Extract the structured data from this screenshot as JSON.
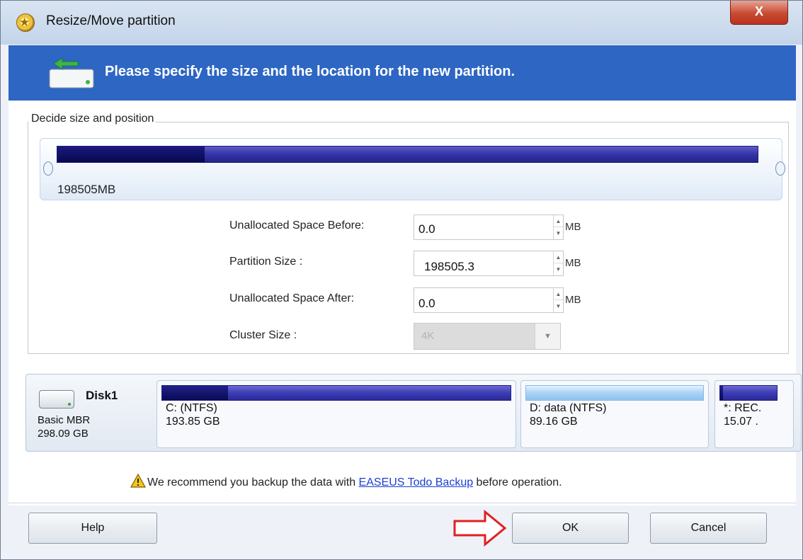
{
  "window": {
    "title": "Resize/Move partition",
    "close_label": "X"
  },
  "banner": {
    "text": "Please specify the size and the location for the new partition."
  },
  "group": {
    "label": "Decide size and position",
    "partition_size_label": "198505MB",
    "used_fraction": 0.21
  },
  "fields": {
    "before": {
      "label": "Unallocated Space Before:",
      "value": "0.0",
      "unit": "MB"
    },
    "size": {
      "label": "Partition Size :",
      "value": "198505.3",
      "unit": "MB"
    },
    "after": {
      "label": "Unallocated Space After:",
      "value": "0.0",
      "unit": "MB"
    },
    "cluster": {
      "label": "Cluster Size :",
      "value": "4K"
    }
  },
  "disk": {
    "name": "Disk1",
    "type": "Basic MBR",
    "size": "298.09 GB",
    "partitions": [
      {
        "name": "C: (NTFS)",
        "size": "193.85 GB",
        "used_fraction": 0.19
      },
      {
        "name": "D: data (NTFS)",
        "size": "89.16 GB",
        "used_fraction": 0.0
      },
      {
        "name": "*: REC.",
        "size": "15.07 .",
        "used_fraction": 0.05
      }
    ]
  },
  "warning": {
    "prefix": "We recommend you backup the data with ",
    "link": "EASEUS Todo Backup",
    "suffix": " before operation."
  },
  "buttons": {
    "help": "Help",
    "ok": "OK",
    "cancel": "Cancel"
  },
  "colors": {
    "banner": "#2d66c3",
    "bar_dark": "#08084e",
    "bar_free": "#3434a8",
    "bar_light": "#a9d2f6",
    "annotation_arrow": "#e02020"
  }
}
